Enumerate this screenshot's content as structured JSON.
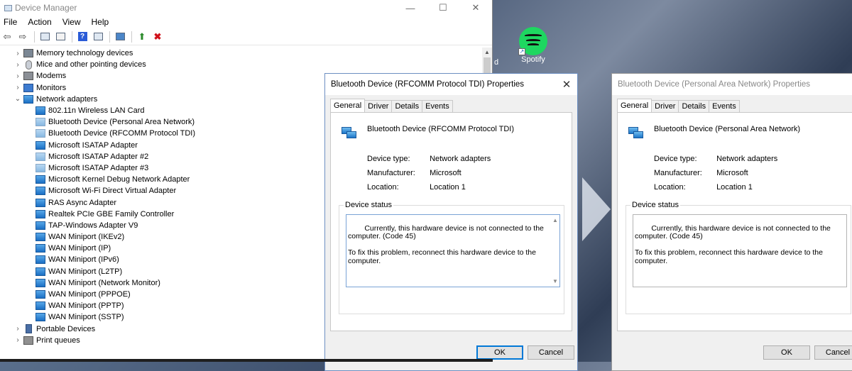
{
  "desktop": {
    "spotify_label": "Spotify",
    "left_partial_label": "d"
  },
  "device_manager": {
    "title": "Device Manager",
    "window_controls": [
      "—",
      "☐",
      "✕"
    ],
    "menu": [
      "File",
      "Action",
      "View",
      "Help"
    ],
    "tree": [
      {
        "kind": "cat",
        "expander": ">",
        "icon": "memory-icon",
        "label": "Memory technology devices"
      },
      {
        "kind": "cat",
        "expander": ">",
        "icon": "mouse-icon",
        "label": "Mice and other pointing devices"
      },
      {
        "kind": "cat",
        "expander": ">",
        "icon": "modem-icon",
        "label": "Modems"
      },
      {
        "kind": "cat",
        "expander": ">",
        "icon": "monitor-icon",
        "label": "Monitors"
      },
      {
        "kind": "cat",
        "expander": "v",
        "icon": "network-adapter-icon",
        "label": "Network adapters"
      },
      {
        "kind": "child",
        "icon": "network-adapter-icon",
        "label": "802.11n Wireless LAN Card"
      },
      {
        "kind": "child",
        "icon": "network-adapter-disabled-icon",
        "label": "Bluetooth Device (Personal Area Network)"
      },
      {
        "kind": "child",
        "icon": "network-adapter-disabled-icon",
        "label": "Bluetooth Device (RFCOMM Protocol TDI)"
      },
      {
        "kind": "child",
        "icon": "network-adapter-icon",
        "label": "Microsoft ISATAP Adapter"
      },
      {
        "kind": "child",
        "icon": "network-adapter-disabled-icon",
        "label": "Microsoft ISATAP Adapter #2"
      },
      {
        "kind": "child",
        "icon": "network-adapter-disabled-icon",
        "label": "Microsoft ISATAP Adapter #3"
      },
      {
        "kind": "child",
        "icon": "network-adapter-icon",
        "label": "Microsoft Kernel Debug Network Adapter"
      },
      {
        "kind": "child",
        "icon": "network-adapter-icon",
        "label": "Microsoft Wi-Fi Direct Virtual Adapter"
      },
      {
        "kind": "child",
        "icon": "network-adapter-icon",
        "label": "RAS Async Adapter"
      },
      {
        "kind": "child",
        "icon": "network-adapter-icon",
        "label": "Realtek PCIe GBE Family Controller"
      },
      {
        "kind": "child",
        "icon": "network-adapter-icon",
        "label": "TAP-Windows Adapter V9"
      },
      {
        "kind": "child",
        "icon": "network-adapter-icon",
        "label": "WAN Miniport (IKEv2)"
      },
      {
        "kind": "child",
        "icon": "network-adapter-icon",
        "label": "WAN Miniport (IP)"
      },
      {
        "kind": "child",
        "icon": "network-adapter-icon",
        "label": "WAN Miniport (IPv6)"
      },
      {
        "kind": "child",
        "icon": "network-adapter-icon",
        "label": "WAN Miniport (L2TP)"
      },
      {
        "kind": "child",
        "icon": "network-adapter-icon",
        "label": "WAN Miniport (Network Monitor)"
      },
      {
        "kind": "child",
        "icon": "network-adapter-icon",
        "label": "WAN Miniport (PPPOE)"
      },
      {
        "kind": "child",
        "icon": "network-adapter-icon",
        "label": "WAN Miniport (PPTP)"
      },
      {
        "kind": "child",
        "icon": "network-adapter-icon",
        "label": "WAN Miniport (SSTP)"
      },
      {
        "kind": "cat",
        "expander": ">",
        "icon": "portable-device-icon",
        "label": "Portable Devices"
      },
      {
        "kind": "cat",
        "expander": ">",
        "icon": "printer-icon",
        "label": "Print queues"
      }
    ]
  },
  "dialog_rfcomm": {
    "title": "Bluetooth Device (RFCOMM Protocol TDI) Properties",
    "tabs": [
      "General",
      "Driver",
      "Details",
      "Events"
    ],
    "device_name": "Bluetooth Device (RFCOMM Protocol TDI)",
    "device_type_label": "Device type:",
    "device_type": "Network adapters",
    "manufacturer_label": "Manufacturer:",
    "manufacturer": "Microsoft",
    "location_label": "Location:",
    "location": "Location 1",
    "status_group_label": "Device status",
    "status_text": "Currently, this hardware device is not connected to the computer. (Code 45)\n\nTo fix this problem, reconnect this hardware device to the computer.",
    "ok_label": "OK",
    "cancel_label": "Cancel"
  },
  "dialog_pan": {
    "title": "Bluetooth Device (Personal Area Network) Properties",
    "tabs": [
      "General",
      "Driver",
      "Details",
      "Events"
    ],
    "device_name": "Bluetooth Device (Personal Area Network)",
    "device_type_label": "Device type:",
    "device_type": "Network adapters",
    "manufacturer_label": "Manufacturer:",
    "manufacturer": "Microsoft",
    "location_label": "Location:",
    "location": "Location 1",
    "status_group_label": "Device status",
    "status_text": "Currently, this hardware device is not connected to the computer. (Code 45)\n\nTo fix this problem, reconnect this hardware device to the computer.",
    "ok_label": "OK",
    "cancel_label": "Cancel"
  }
}
